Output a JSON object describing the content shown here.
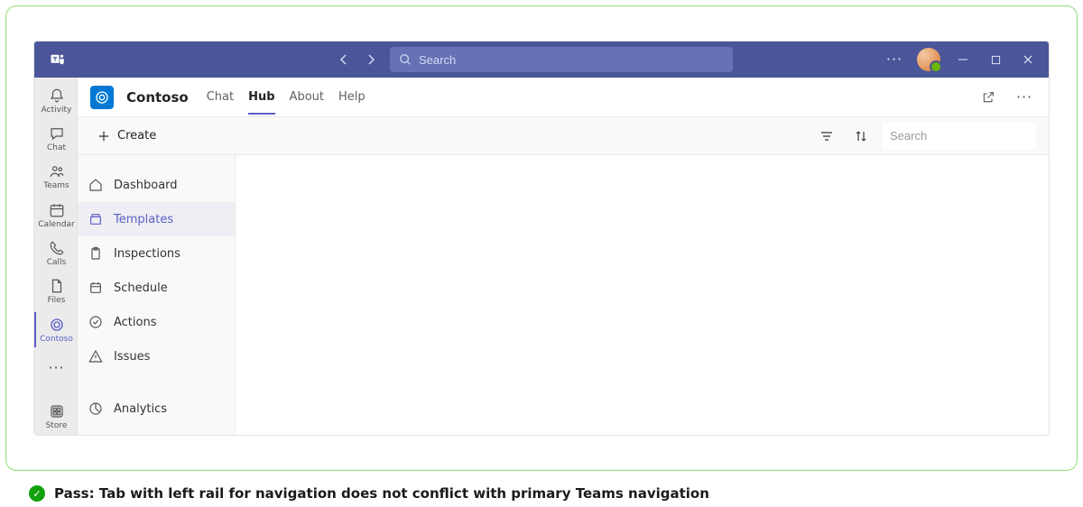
{
  "title_search_placeholder": "Search",
  "app_rail": [
    {
      "id": "activity",
      "label": "Activity"
    },
    {
      "id": "chat",
      "label": "Chat"
    },
    {
      "id": "teams",
      "label": "Teams"
    },
    {
      "id": "calendar",
      "label": "Calendar"
    },
    {
      "id": "calls",
      "label": "Calls"
    },
    {
      "id": "files",
      "label": "Files"
    },
    {
      "id": "contoso",
      "label": "Contoso",
      "active": true
    }
  ],
  "store_label": "Store",
  "header": {
    "app_name": "Contoso",
    "tabs": [
      {
        "label": "Chat"
      },
      {
        "label": "Hub",
        "active": true
      },
      {
        "label": "About"
      },
      {
        "label": "Help"
      }
    ]
  },
  "toolbar": {
    "create_label": "Create",
    "search_placeholder": "Search"
  },
  "sidenav": {
    "items": [
      {
        "label": "Dashboard",
        "icon": "home"
      },
      {
        "label": "Templates",
        "icon": "template",
        "active": true
      },
      {
        "label": "Inspections",
        "icon": "clipboard"
      },
      {
        "label": "Schedule",
        "icon": "calendar"
      },
      {
        "label": "Actions",
        "icon": "check"
      },
      {
        "label": "Issues",
        "icon": "alert"
      }
    ],
    "separator_then": {
      "label": "Analytics",
      "icon": "analytics"
    }
  },
  "pass_caption": "Pass: Tab with left rail for navigation does not conflict with primary Teams navigation"
}
